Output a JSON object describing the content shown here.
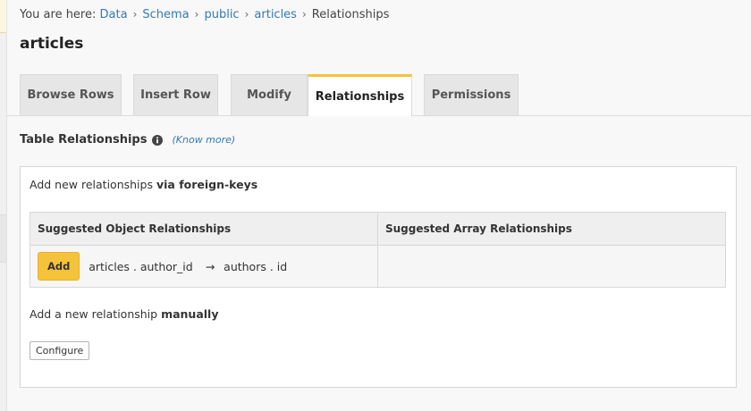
{
  "breadcrumb": {
    "prefix": "You are here:",
    "items": [
      "Data",
      "Schema",
      "public",
      "articles",
      "Relationships"
    ],
    "separator": "›"
  },
  "page": {
    "title": "articles"
  },
  "tabs": [
    {
      "label": "Browse Rows",
      "active": false
    },
    {
      "label": "Insert Row",
      "active": false
    },
    {
      "label": "Modify",
      "active": false
    },
    {
      "label": "Relationships",
      "active": true
    },
    {
      "label": "Permissions",
      "active": false
    }
  ],
  "section": {
    "title": "Table Relationships",
    "info_icon": "info-circle-icon",
    "know_more": "(Know more)"
  },
  "foreign_keys": {
    "text": "Add new relationships",
    "emphasis": "via foreign-keys"
  },
  "table": {
    "headers": [
      "Suggested Object Relationships",
      "Suggested Array Relationships"
    ],
    "rows": [
      {
        "add_label": "Add",
        "from": "articles . author_id",
        "arrow": "→",
        "to": "authors . id",
        "array": ""
      }
    ]
  },
  "manual": {
    "text": "Add a new relationship",
    "emphasis": "manually",
    "button_label": "Configure"
  },
  "colors": {
    "accent": "#f5c33b",
    "link": "#337ab7"
  }
}
